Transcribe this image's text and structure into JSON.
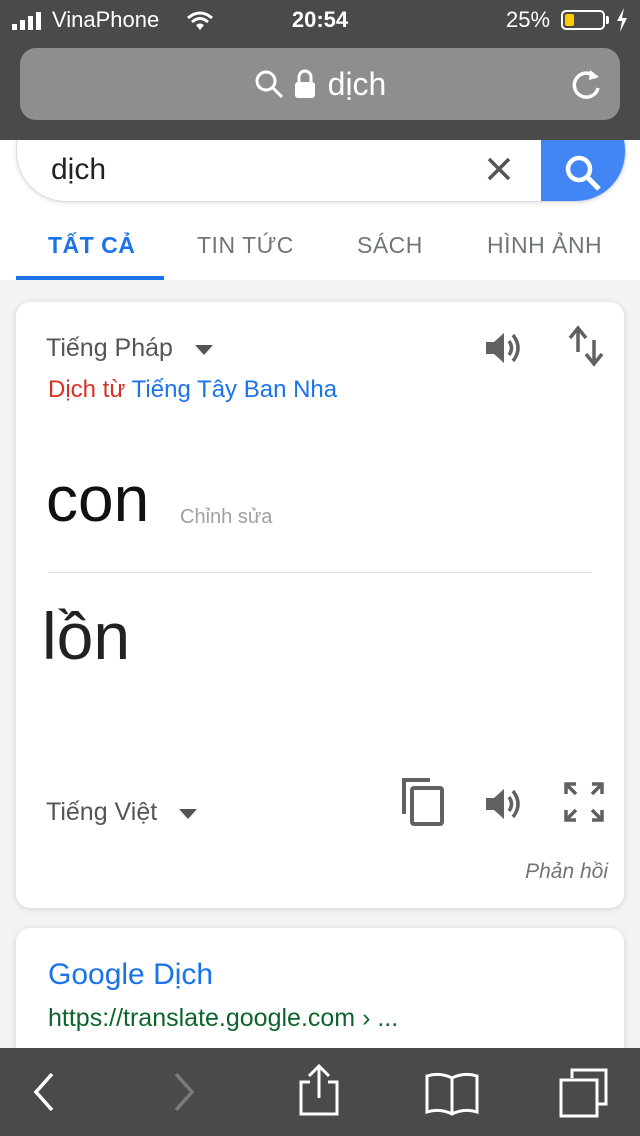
{
  "status_bar": {
    "carrier": "VinaPhone",
    "time": "20:54",
    "battery_percent": "25%",
    "battery_level": 0.25
  },
  "browser": {
    "url_text": "dịch"
  },
  "search": {
    "query": "dịch"
  },
  "tabs": [
    {
      "label": "TẤT CẢ",
      "active": true
    },
    {
      "label": "TIN TỨC"
    },
    {
      "label": "SÁCH"
    },
    {
      "label": "HÌNH ẢNH"
    }
  ],
  "translate": {
    "source_language": "Tiếng Pháp",
    "detected_prefix": "Dịch từ",
    "detected_language": "Tiếng Tây Ban Nha",
    "source_text": "con",
    "edit_label": "Chỉnh sửa",
    "translated_text": "lồn",
    "target_language": "Tiếng Việt",
    "feedback_label": "Phản hồi"
  },
  "result": {
    "title": "Google Dịch",
    "url": "https://translate.google.com › ..."
  }
}
